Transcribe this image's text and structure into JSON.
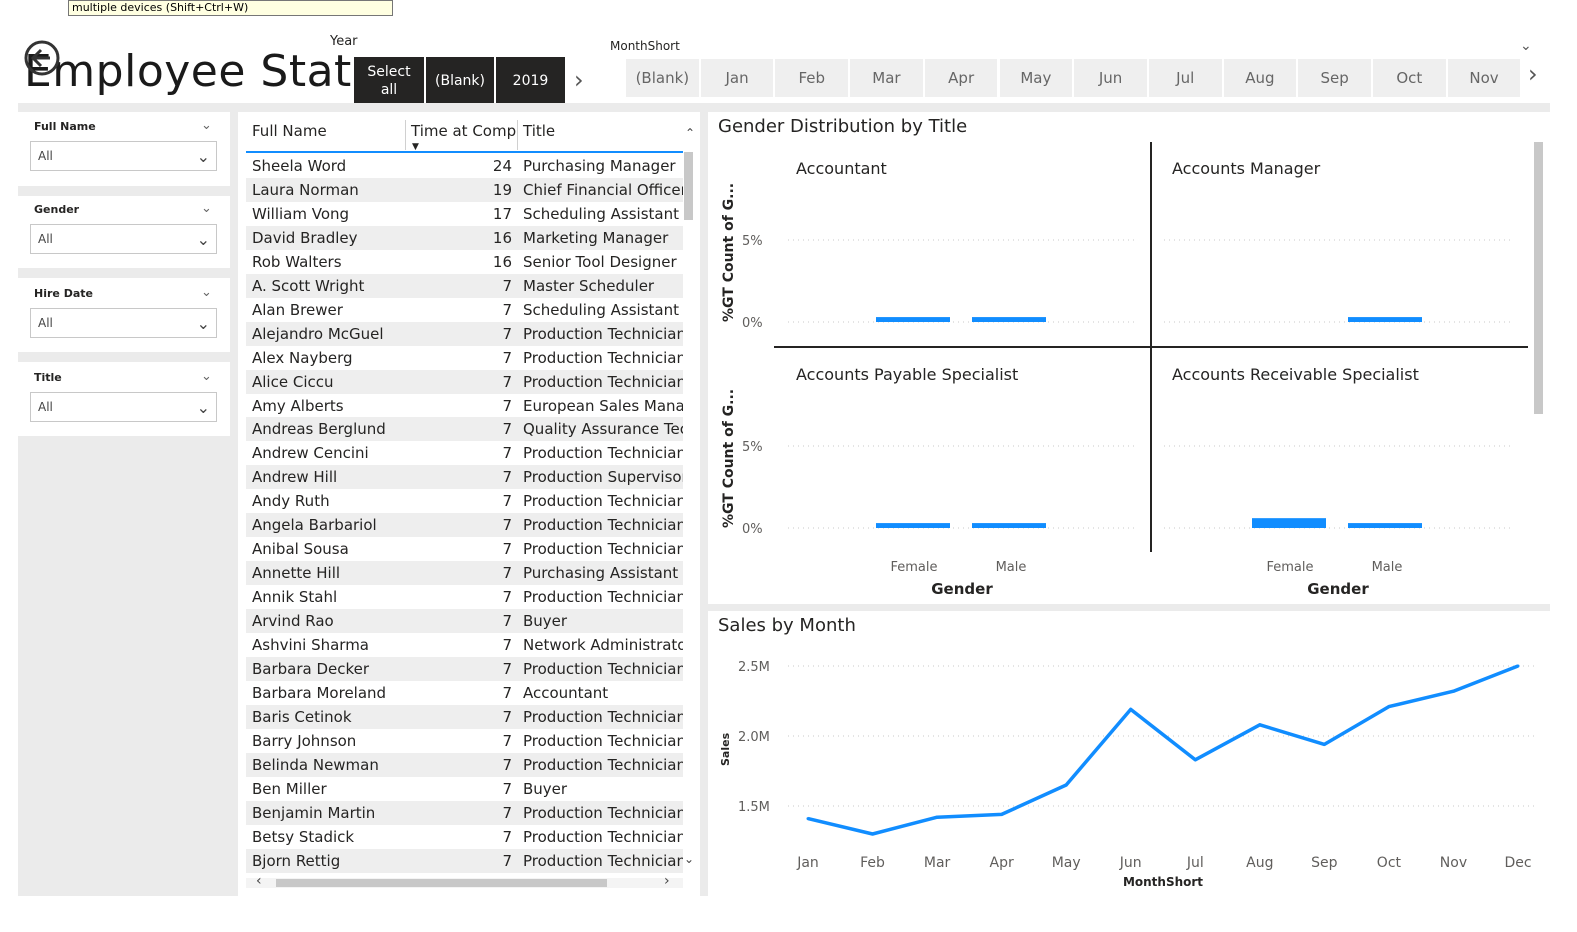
{
  "tooltip": "multiple devices (Shift+Ctrl+W)",
  "page_title": "Employee Stats",
  "year_slicer": {
    "label": "Year",
    "buttons": [
      "Select all",
      "(Blank)",
      "2019"
    ]
  },
  "month_slicer": {
    "label": "MonthShort",
    "buttons": [
      "(Blank)",
      "Jan",
      "Feb",
      "Mar",
      "Apr",
      "May",
      "Jun",
      "Jul",
      "Aug",
      "Sep",
      "Oct",
      "Nov"
    ]
  },
  "slicers": [
    {
      "title": "Full Name",
      "value": "All"
    },
    {
      "title": "Gender",
      "value": "All"
    },
    {
      "title": "Hire Date",
      "value": "All"
    },
    {
      "title": "Title",
      "value": "All"
    }
  ],
  "table": {
    "columns": [
      "Full Name",
      "Time at Comp",
      "Title"
    ],
    "rows": [
      [
        "Sheela Word",
        "24",
        "Purchasing Manager"
      ],
      [
        "Laura Norman",
        "19",
        "Chief Financial Officer"
      ],
      [
        "William Vong",
        "17",
        "Scheduling Assistant"
      ],
      [
        "David Bradley",
        "16",
        "Marketing Manager"
      ],
      [
        "Rob Walters",
        "16",
        "Senior Tool Designer"
      ],
      [
        "A. Scott Wright",
        "7",
        "Master Scheduler"
      ],
      [
        "Alan Brewer",
        "7",
        "Scheduling Assistant"
      ],
      [
        "Alejandro McGuel",
        "7",
        "Production Technician"
      ],
      [
        "Alex Nayberg",
        "7",
        "Production Technician"
      ],
      [
        "Alice Ciccu",
        "7",
        "Production Technician"
      ],
      [
        "Amy Alberts",
        "7",
        "European Sales Manag"
      ],
      [
        "Andreas Berglund",
        "7",
        "Quality Assurance Tech"
      ],
      [
        "Andrew Cencini",
        "7",
        "Production Technician"
      ],
      [
        "Andrew Hill",
        "7",
        "Production Supervisor"
      ],
      [
        "Andy Ruth",
        "7",
        "Production Technician"
      ],
      [
        "Angela Barbariol",
        "7",
        "Production Technician"
      ],
      [
        "Anibal Sousa",
        "7",
        "Production Technician"
      ],
      [
        "Annette Hill",
        "7",
        "Purchasing Assistant"
      ],
      [
        "Annik Stahl",
        "7",
        "Production Technician"
      ],
      [
        "Arvind Rao",
        "7",
        "Buyer"
      ],
      [
        "Ashvini Sharma",
        "7",
        "Network Administrator"
      ],
      [
        "Barbara Decker",
        "7",
        "Production Technician"
      ],
      [
        "Barbara Moreland",
        "7",
        "Accountant"
      ],
      [
        "Baris Cetinok",
        "7",
        "Production Technician"
      ],
      [
        "Barry Johnson",
        "7",
        "Production Technician"
      ],
      [
        "Belinda Newman",
        "7",
        "Production Technician"
      ],
      [
        "Ben Miller",
        "7",
        "Buyer"
      ],
      [
        "Benjamin Martin",
        "7",
        "Production Technician"
      ],
      [
        "Betsy Stadick",
        "7",
        "Production Technician"
      ],
      [
        "Bjorn Rettig",
        "7",
        "Production Technician"
      ]
    ]
  },
  "colors": {
    "accent": "#118DFF",
    "dark_button": "#252423"
  },
  "chart_data": [
    {
      "type": "bar",
      "title": "Gender Distribution by Title",
      "xlabel": "Gender",
      "ylabel": "%GT Count of G...",
      "y_ticks": [
        "5%",
        "0%"
      ],
      "categories": [
        "Female",
        "Male"
      ],
      "facets": [
        {
          "name": "Accountant",
          "values": [
            0.3,
            0.3
          ]
        },
        {
          "name": "Accounts Manager",
          "values": [
            0,
            0.3
          ]
        },
        {
          "name": "Accounts Payable Specialist",
          "values": [
            0.3,
            0.3
          ]
        },
        {
          "name": "Accounts Receivable Specialist",
          "values": [
            0.6,
            0.3
          ]
        }
      ],
      "ylim": [
        0,
        6
      ]
    },
    {
      "type": "line",
      "title": "Sales by Month",
      "xlabel": "MonthShort",
      "ylabel": "Sales",
      "y_ticks": [
        "2.5M",
        "2.0M",
        "1.5M"
      ],
      "categories": [
        "Jan",
        "Feb",
        "Mar",
        "Apr",
        "May",
        "Jun",
        "Jul",
        "Aug",
        "Sep",
        "Oct",
        "Nov",
        "Dec"
      ],
      "values": [
        1.41,
        1.3,
        1.42,
        1.44,
        1.65,
        2.19,
        1.83,
        2.08,
        1.94,
        2.21,
        2.32,
        2.5
      ],
      "ylim": [
        1.2,
        2.6
      ]
    }
  ]
}
